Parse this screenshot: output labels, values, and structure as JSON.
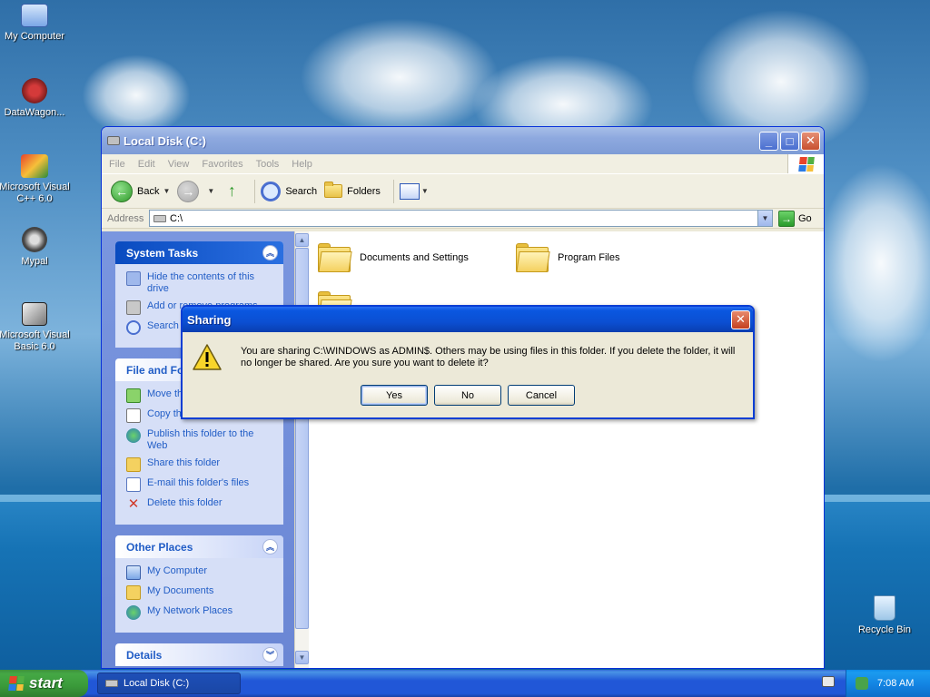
{
  "desktop": {
    "icons": [
      {
        "label": "My Computer"
      },
      {
        "label": "DataWagon..."
      },
      {
        "label": "Microsoft Visual C++ 6.0"
      },
      {
        "label": "Mypal"
      },
      {
        "label": "Microsoft Visual Basic 6.0"
      },
      {
        "label": "Recycle Bin"
      }
    ]
  },
  "window": {
    "title": "Local Disk (C:)",
    "menu": [
      "File",
      "Edit",
      "View",
      "Favorites",
      "Tools",
      "Help"
    ],
    "toolbar": {
      "back_label": "Back",
      "search_label": "Search",
      "folders_label": "Folders"
    },
    "address": {
      "label": "Address",
      "value": "C:\\",
      "go_label": "Go"
    },
    "panels": {
      "system_tasks": {
        "title": "System Tasks",
        "items": [
          "Hide the contents of this drive",
          "Add or remove programs",
          "Search for files or folders"
        ]
      },
      "file_folder_tasks": {
        "title": "File and Folder Tasks",
        "items": [
          "Move this folder",
          "Copy this folder",
          "Publish this folder to the Web",
          "Share this folder",
          "E-mail this folder's files",
          "Delete this folder"
        ]
      },
      "other_places": {
        "title": "Other Places",
        "items": [
          "My Computer",
          "My Documents",
          "My Network Places"
        ]
      },
      "details": {
        "title": "Details"
      }
    },
    "folders": [
      "Documents and Settings",
      "Program Files"
    ]
  },
  "dialog": {
    "title": "Sharing",
    "message": "You are sharing C:\\WINDOWS as ADMIN$. Others may be using files in this folder. If you delete the folder, it will no longer be shared. Are you sure you want to delete it?",
    "buttons": {
      "yes": "Yes",
      "no": "No",
      "cancel": "Cancel"
    }
  },
  "taskbar": {
    "start_label": "start",
    "task_item": "Local Disk (C:)",
    "clock": "7:08 AM"
  },
  "colors": {
    "title_active": "#0a57e0",
    "task_link": "#215dc6",
    "start_green": "#3a9a3a"
  }
}
